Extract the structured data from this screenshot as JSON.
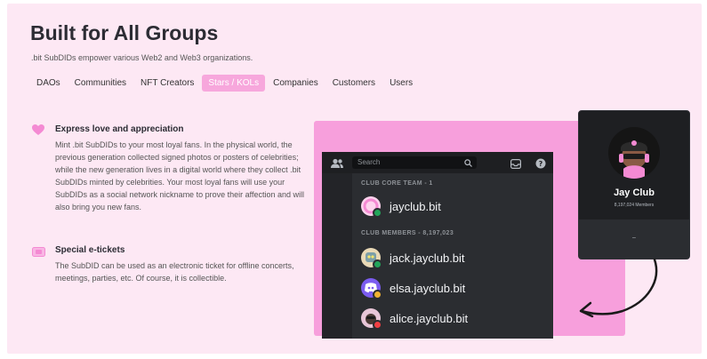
{
  "header": {
    "title": "Built for All Groups",
    "subtitle": ".bit SubDIDs empower various Web2 and Web3 organizations."
  },
  "tabs": [
    {
      "label": "DAOs",
      "active": false
    },
    {
      "label": "Communities",
      "active": false
    },
    {
      "label": "NFT Creators",
      "active": false
    },
    {
      "label": "Stars / KOLs",
      "active": true
    },
    {
      "label": "Companies",
      "active": false
    },
    {
      "label": "Customers",
      "active": false
    },
    {
      "label": "Users",
      "active": false
    }
  ],
  "features": [
    {
      "icon": "heart-icon",
      "title": "Express love and appreciation",
      "body": "Mint .bit SubDIDs to your most loyal fans. In the physical world, the previous generation collected signed photos or posters of celebrities; while the new generation lives in a digital world where they collect .bit SubDIDs minted by celebrities. Your most loyal fans will use your SubDIDs as a social network nickname to prove their affection and will also bring you new fans."
    },
    {
      "icon": "ticket-icon",
      "title": "Special e-tickets",
      "body": "The SubDID can be used as an electronic ticket for offline concerts, meetings, parties, etc. Of course, it is collectible."
    }
  ],
  "discord": {
    "search_placeholder": "Search",
    "core_section": "CLUB CORE TEAM - 1",
    "members_section": "CLUB MEMBERS - 8,197,023",
    "core_members": [
      {
        "name": "jayclub.bit",
        "avatar": "pink-ring-avatar",
        "status_color": "#23a55a"
      }
    ],
    "members": [
      {
        "name": "jack.jayclub.bit",
        "avatar": "robot-avatar",
        "status_color": "#23a55a"
      },
      {
        "name": "elsa.jayclub.bit",
        "avatar": "discord-logo-avatar",
        "status_color": "#f0b232"
      },
      {
        "name": "alice.jayclub.bit",
        "avatar": "character-avatar",
        "status_color": "#f23f43"
      }
    ]
  },
  "profile_card": {
    "name": "Jay Club",
    "members_text": "8,197,024 Members",
    "footer": "–"
  },
  "colors": {
    "background": "#fde8f4",
    "accent_pink": "#f7a7dc",
    "discord_dark": "#1e1f22"
  }
}
